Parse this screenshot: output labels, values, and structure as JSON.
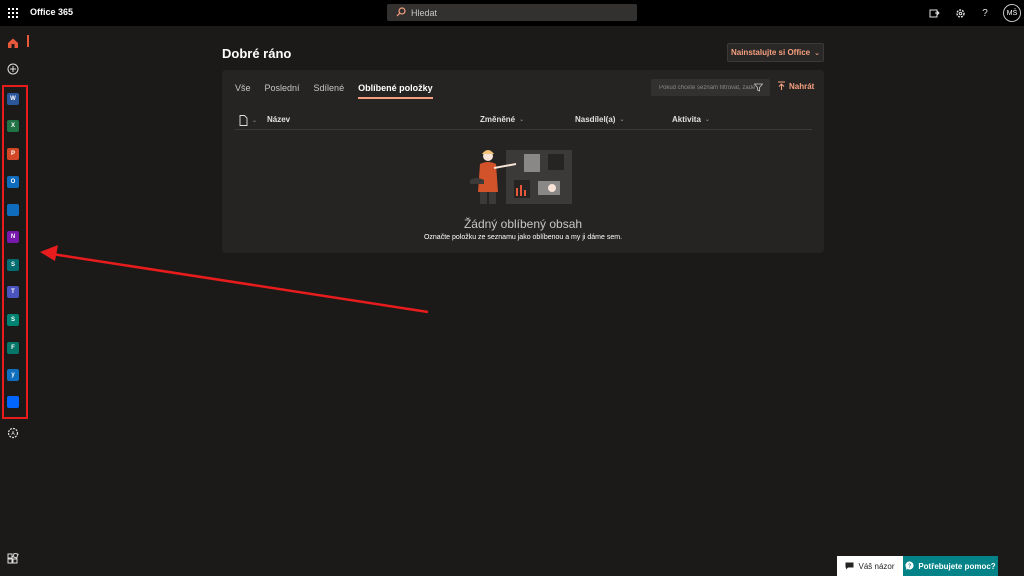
{
  "header": {
    "brand": "Office 365",
    "search_placeholder": "Hledat",
    "avatar_initials": "MŠ"
  },
  "rail": {
    "apps": [
      {
        "name": "word",
        "letter": "W",
        "color": "#2b579a"
      },
      {
        "name": "excel",
        "letter": "X",
        "color": "#217346"
      },
      {
        "name": "powerpoint",
        "letter": "P",
        "color": "#d24726"
      },
      {
        "name": "outlook",
        "letter": "O",
        "color": "#0f6cbd"
      },
      {
        "name": "onedrive",
        "letter": "",
        "color": "#0f6cbd"
      },
      {
        "name": "onenote",
        "letter": "N",
        "color": "#7719aa"
      },
      {
        "name": "sharepoint",
        "letter": "S",
        "color": "#036c70"
      },
      {
        "name": "teams",
        "letter": "T",
        "color": "#4b53bc"
      },
      {
        "name": "sway",
        "letter": "S",
        "color": "#008272"
      },
      {
        "name": "forms",
        "letter": "F",
        "color": "#077568"
      },
      {
        "name": "yammer",
        "letter": "y",
        "color": "#106ebe"
      },
      {
        "name": "power-automate",
        "letter": "",
        "color": "#0066ff"
      }
    ]
  },
  "main": {
    "greeting": "Dobré ráno",
    "install_label": "Nainstalujte si Office",
    "tabs": [
      {
        "label": "Vše",
        "active": false
      },
      {
        "label": "Poslední",
        "active": false
      },
      {
        "label": "Sdílené",
        "active": false
      },
      {
        "label": "Oblíbené položky",
        "active": true
      }
    ],
    "filter_placeholder": "Pokud chcete seznam filtrovat, zadejte",
    "upload_label": "Nahrát",
    "columns": [
      "Název",
      "Změněné",
      "Nasdílel(a)",
      "Aktivita"
    ],
    "empty_title": "Žádný oblíbený obsah",
    "empty_desc": "Označte položku ze seznamu jako oblíbenou a my ji dáme sem."
  },
  "footer": {
    "feedback_label": "Váš názor",
    "help_label": "Potřebujete pomoc?"
  },
  "colors": {
    "accent": "#f7a07f",
    "annotation": "#e81c1c",
    "help_bg": "#038387"
  }
}
